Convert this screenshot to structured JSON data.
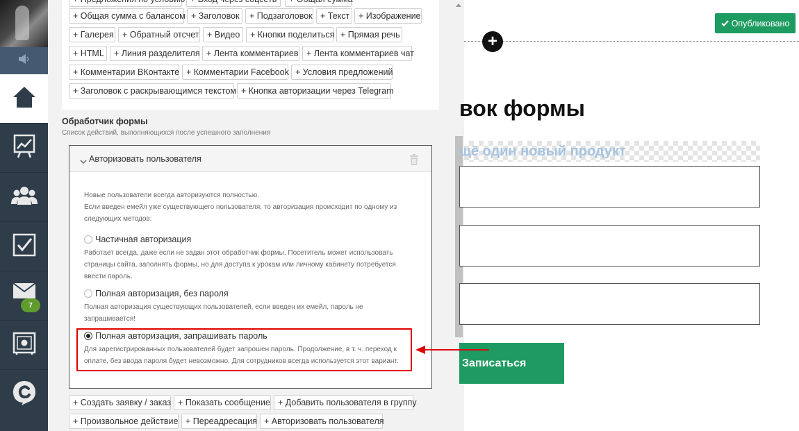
{
  "sidebar": {
    "items": [
      {
        "name": "home",
        "icon": "home-icon"
      },
      {
        "name": "analytics",
        "icon": "chart-icon"
      },
      {
        "name": "users",
        "icon": "users-icon"
      },
      {
        "name": "tasks",
        "icon": "checkbox-icon"
      },
      {
        "name": "messages",
        "icon": "envelope-icon",
        "badge": "7"
      },
      {
        "name": "settings",
        "icon": "safe-icon"
      },
      {
        "name": "brand",
        "icon": "getcourse-logo-icon"
      }
    ]
  },
  "blocks": {
    "top_chips": [
      "+ Предложения по условию",
      "+ Вход через соцсеть",
      "+ Общая сумма"
    ],
    "chips": [
      "+ Общая сумма с балансом",
      "+ Заголовок",
      "+ Подзаголовок",
      "+ Текст",
      "+ Изображение",
      "+ Галерея",
      "+ Обратный отсчет",
      "+ Видео",
      "+ Кнопки поделиться",
      "+ Прямая речь",
      "+ HTML",
      "+ Линия разделителя",
      "+ Лента комментариев",
      "+ Лента комментариев чат",
      "+ Комментарии ВКонтакте",
      "+ Комментарии Facebook",
      "+ Условия предложений",
      "+ Заголовок с раскрывающимся текстом",
      "+ Кнопка авторизации через Telegram"
    ]
  },
  "handler": {
    "title": "Обработчик формы",
    "subtitle": "Список действий, выполняющихся после успешного заполнения",
    "action_title": "Авторизовать пользователя",
    "intro_1": "Новые пользователи всегда авторизуются полностью.",
    "intro_2": "Если введен емейл уже существующего пользователя, то авторизация происходит по одному из",
    "intro_3": "следующих методов:",
    "options": [
      {
        "label": "Частичная авторизация",
        "desc": [
          "Работает всегда, даже если не задан этот обработчик формы. Посетитель может использовать",
          "страницы сайта, заполнять формы, но для доступа к урокам или личному кабинету потребуется",
          "ввести пароль."
        ],
        "checked": false
      },
      {
        "label": "Полная авторизация, без пароля",
        "desc": [
          "Полная авторизация существующих пользователей, если введен их емейл, пароль не",
          "запрашивается!"
        ],
        "checked": false
      },
      {
        "label": "Полная авторизация, запрашивать пароль",
        "desc": [
          "Для зарегистрированных пользователей будет запрошен пароль. Продолжение, в т. ч. переход к",
          "оплате, без ввода пароля будет невозможно. Для сотрудников всегда используется этот вариант."
        ],
        "checked": true
      }
    ],
    "action_chips": [
      "+ Создать заявку / заказ",
      "+ Показать сообщение",
      "+ Добавить пользователя в группу",
      "+ Произвольное действие",
      "+ Переадресация",
      "+ Авторизовать пользователя"
    ]
  },
  "preview": {
    "status": "Опубликовано",
    "heading": "вок формы",
    "product_text": "щё один новый продукт",
    "submit_label": "Записаться"
  },
  "colors": {
    "sidebar": "#2f3d4a",
    "accent_green": "#1e9b61",
    "highlight_red": "#e00000",
    "badge_green": "#5f9b2f"
  }
}
